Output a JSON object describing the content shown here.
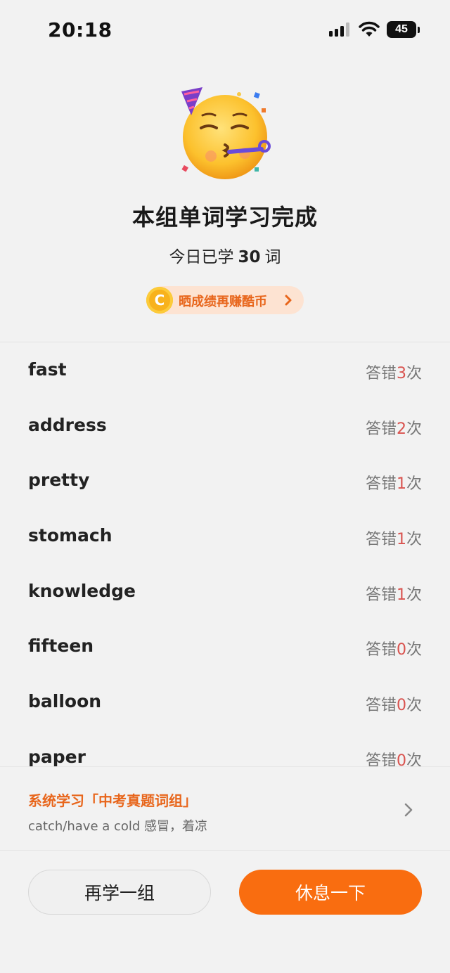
{
  "status_bar": {
    "time": "20:18",
    "battery": "45"
  },
  "hero": {
    "emoji": "partying-face-icon",
    "title": "本组单词学习完成",
    "subtitle_prefix": "今日已学",
    "words_today": "30",
    "subtitle_suffix": "词",
    "share_label": "晒成绩再赚酷币"
  },
  "words": [
    {
      "word": "fast",
      "err_prefix": "答错",
      "count": "3",
      "err_suffix": "次"
    },
    {
      "word": "address",
      "err_prefix": "答错",
      "count": "2",
      "err_suffix": "次"
    },
    {
      "word": "pretty",
      "err_prefix": "答错",
      "count": "1",
      "err_suffix": "次"
    },
    {
      "word": "stomach",
      "err_prefix": "答错",
      "count": "1",
      "err_suffix": "次"
    },
    {
      "word": "knowledge",
      "err_prefix": "答错",
      "count": "1",
      "err_suffix": "次"
    },
    {
      "word": "fifteen",
      "err_prefix": "答错",
      "count": "0",
      "err_suffix": "次"
    },
    {
      "word": "balloon",
      "err_prefix": "答错",
      "count": "0",
      "err_suffix": "次"
    },
    {
      "word": "paper",
      "err_prefix": "答错",
      "count": "0",
      "err_suffix": "次"
    }
  ],
  "recommendation": {
    "title": "系统学习「中考真题词组」",
    "subtitle": "catch/have a cold 感冒，着凉"
  },
  "buttons": {
    "again": "再学一组",
    "rest": "休息一下"
  },
  "colors": {
    "accent": "#f96d10",
    "accent_text": "#e8661c",
    "error_count": "#d9534f",
    "coin": "#f8b21c"
  }
}
